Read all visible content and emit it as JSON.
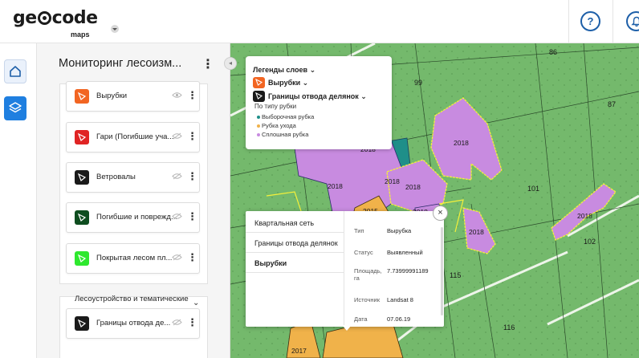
{
  "app": {
    "logo_text_left": "ge",
    "logo_text_right": "code",
    "logo_sub": "maps",
    "help_label": "?"
  },
  "panel": {
    "title": "Мониторинг лесоизм...",
    "menu_icon": "⋮",
    "layers": [
      {
        "label": "Вырубки",
        "color": "#f26522",
        "visibility": "visible"
      },
      {
        "label": "Гари (Погибшие уча...",
        "color": "#e02424",
        "visibility": "hidden"
      },
      {
        "label": "Ветровалы",
        "color": "#1a1a1a",
        "visibility": "hidden"
      },
      {
        "label": "Погибшие и поврежд...",
        "color": "#0e4d1f",
        "visibility": "hidden"
      },
      {
        "label": "Покрытая лесом пл...",
        "color": "#2ee82e",
        "visibility": "hidden"
      }
    ],
    "section2": {
      "title": "Лесоустройство и тематические",
      "layers": [
        {
          "label": "Границы отвода де...",
          "color": "#1a1a1a",
          "visibility": "hidden"
        }
      ]
    }
  },
  "legend": {
    "title": "Легенды слоев",
    "rows": [
      {
        "label": "Вырубки",
        "color": "#f26522"
      },
      {
        "label": "Границы отвода делянок",
        "color": "#1a1a1a"
      }
    ],
    "group_label": "По типу рубки",
    "items": [
      {
        "label": "Выборочная рубка",
        "color": "#1f8f89"
      },
      {
        "label": "Рубка ухода",
        "color": "#f0b24a"
      },
      {
        "label": "Сплошная рубка",
        "color": "#c88be0"
      }
    ]
  },
  "map": {
    "quarter_labels": [
      "86",
      "99",
      "87",
      "101",
      "102",
      "115",
      "116"
    ],
    "year_labels": [
      "2018",
      "2018",
      "2018",
      "2018",
      "2018",
      "2018",
      "2018",
      "2018",
      "2015",
      "2017"
    ],
    "colors": {
      "forest": "#74b96c",
      "clearcut": "#c88be0",
      "selective": "#1f8f89",
      "thinning": "#f0b24a",
      "boundary": "#f5f03a"
    }
  },
  "popup": {
    "tabs": [
      "Квартальная сеть",
      "Границы отвода делянок",
      "Вырубки"
    ],
    "attributes": [
      {
        "key": "Тип",
        "value": "Вырубка"
      },
      {
        "key": "Статус",
        "value": "Выявленный"
      },
      {
        "key": "Площадь, га",
        "value": "7.73999991189"
      },
      {
        "key": "Источник",
        "value": "Landsat 8"
      },
      {
        "key": "Дата",
        "value": "07.06.19"
      }
    ],
    "close_label": "×"
  }
}
